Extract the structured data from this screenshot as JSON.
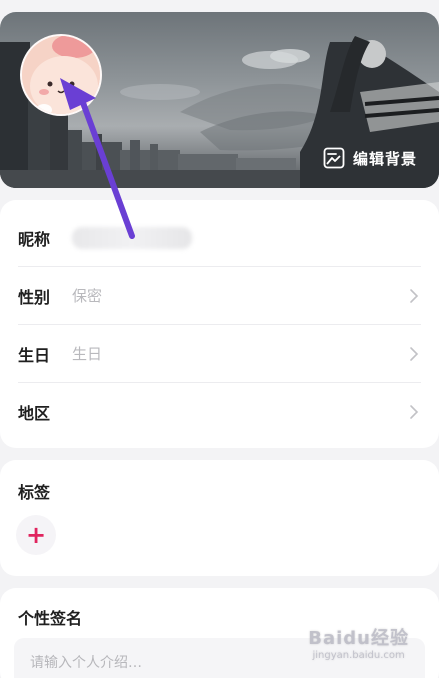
{
  "header": {
    "edit_background_label": "编辑背景",
    "edit_icon": "image-icon"
  },
  "profile": {
    "rows": [
      {
        "label": "昵称",
        "value": ""
      },
      {
        "label": "性别",
        "value": "保密"
      },
      {
        "label": "生日",
        "value": "生日"
      },
      {
        "label": "地区",
        "value": ""
      }
    ]
  },
  "tags": {
    "title": "标签",
    "add_icon": "plus-icon"
  },
  "signature": {
    "title": "个性签名",
    "placeholder": "请输入个人介绍…"
  },
  "watermark": {
    "brand": "Baidu经验",
    "site": "jingyan.baidu.com"
  },
  "colors": {
    "accent": "#e0245e",
    "annotation_arrow": "#6a3fd4"
  }
}
